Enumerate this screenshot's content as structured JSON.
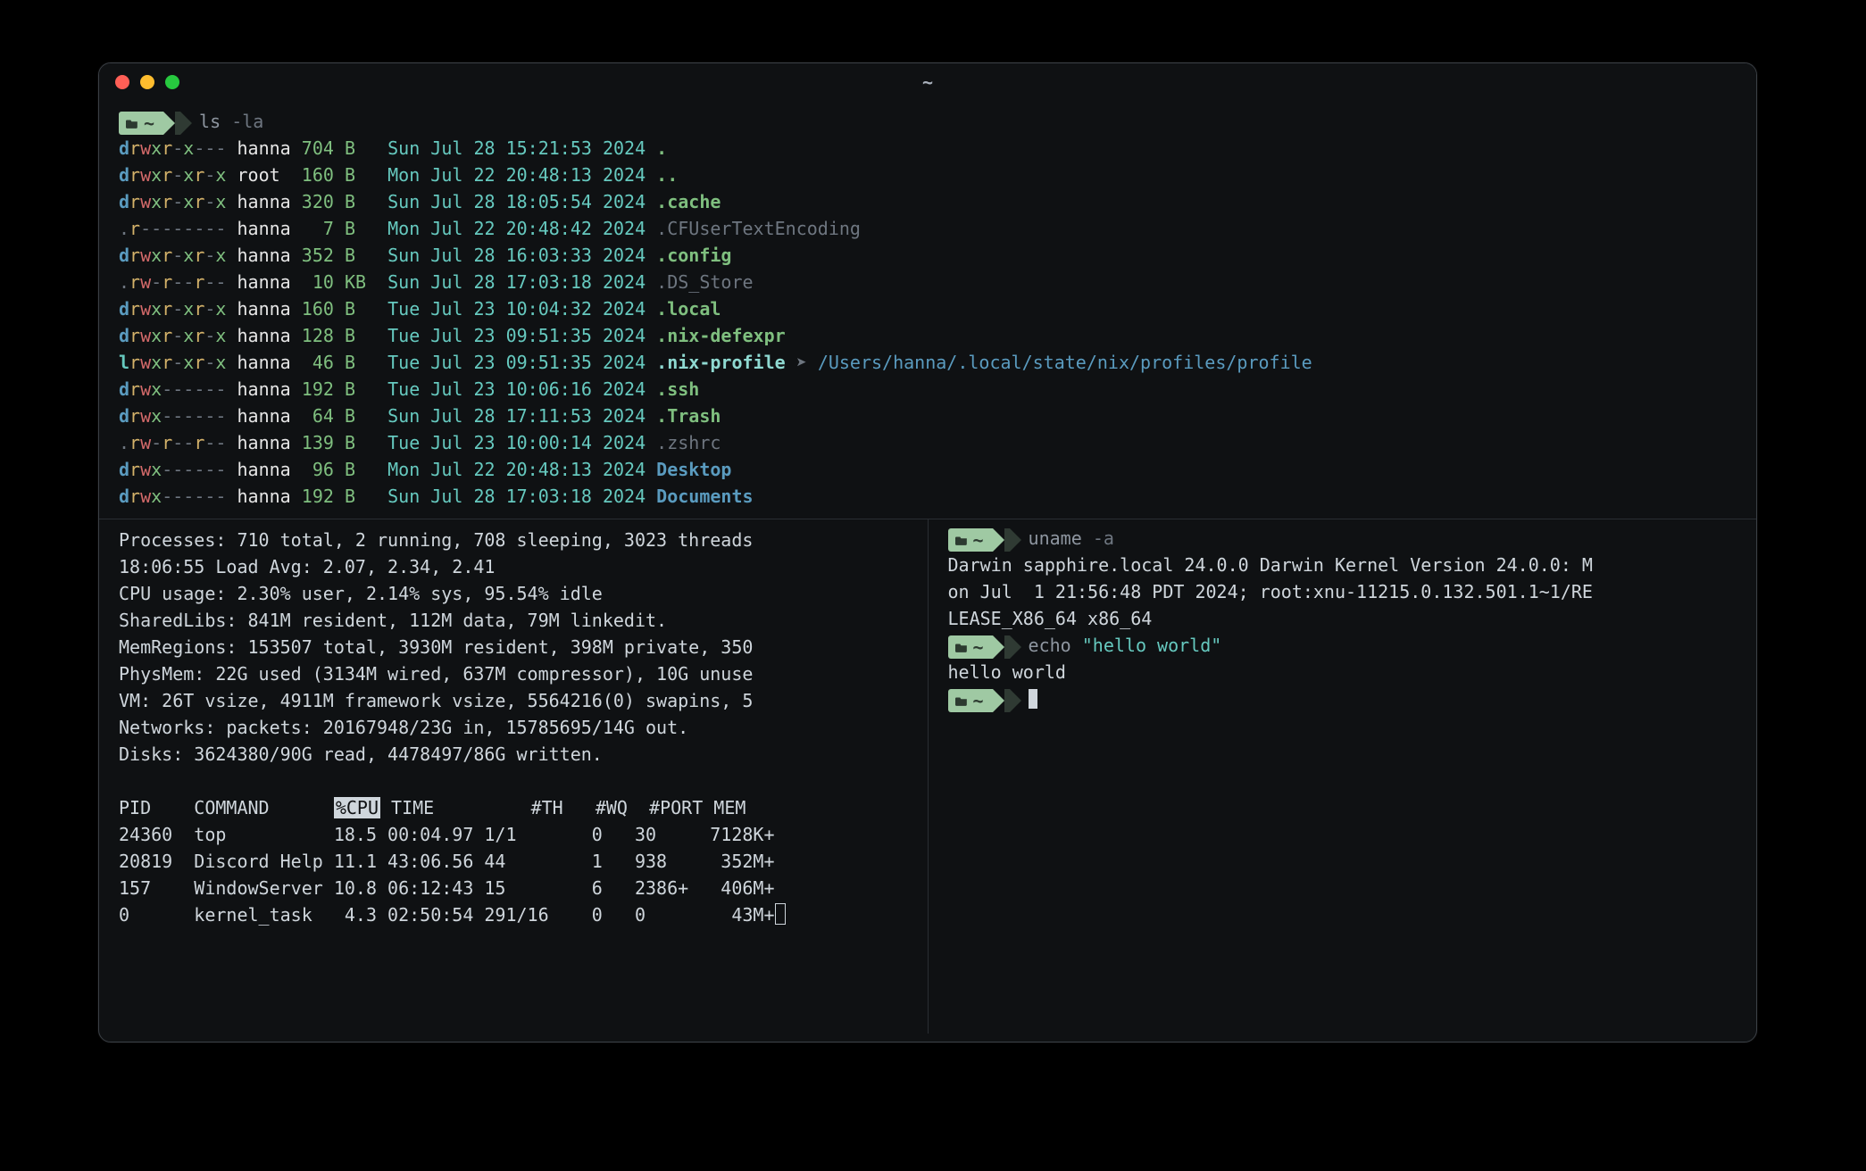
{
  "window": {
    "title": "~"
  },
  "prompt": {
    "cwd": "~"
  },
  "panes": {
    "top": {
      "command": {
        "exe": "ls",
        "args": "-la"
      },
      "rows": [
        {
          "perm_d": "d",
          "perm_u": "rwx",
          "perm_g": "r-x",
          "perm_o": "---",
          "user": "hanna",
          "size": "704",
          "unit": "B ",
          "date": "Sun Jul 28 15:21:53 2024",
          "name": ".",
          "name_style": "green bold"
        },
        {
          "perm_d": "d",
          "perm_u": "rwx",
          "perm_g": "r-x",
          "perm_o": "r-x",
          "user": "root ",
          "size": "160",
          "unit": "B ",
          "date": "Mon Jul 22 20:48:13 2024",
          "name": "..",
          "name_style": "green bold"
        },
        {
          "perm_d": "d",
          "perm_u": "rwx",
          "perm_g": "r-x",
          "perm_o": "r-x",
          "user": "hanna",
          "size": "320",
          "unit": "B ",
          "date": "Sun Jul 28 18:05:54 2024",
          "name": ".cache",
          "name_style": "green bold"
        },
        {
          "perm_d": ".",
          "perm_u": "r--",
          "perm_g": "---",
          "perm_o": "---",
          "user": "hanna",
          "size": "  7",
          "unit": "B ",
          "date": "Mon Jul 22 20:48:42 2024",
          "name": ".CFUserTextEncoding",
          "name_style": "dim"
        },
        {
          "perm_d": "d",
          "perm_u": "rwx",
          "perm_g": "r-x",
          "perm_o": "r-x",
          "user": "hanna",
          "size": "352",
          "unit": "B ",
          "date": "Sun Jul 28 16:03:33 2024",
          "name": ".config",
          "name_style": "green bold"
        },
        {
          "perm_d": ".",
          "perm_u": "rw-",
          "perm_g": "r--",
          "perm_o": "r--",
          "user": "hanna",
          "size": " 10",
          "unit": "KB",
          "date": "Sun Jul 28 17:03:18 2024",
          "name": ".DS_Store",
          "name_style": "dim"
        },
        {
          "perm_d": "d",
          "perm_u": "rwx",
          "perm_g": "r-x",
          "perm_o": "r-x",
          "user": "hanna",
          "size": "160",
          "unit": "B ",
          "date": "Tue Jul 23 10:04:32 2024",
          "name": ".local",
          "name_style": "green bold"
        },
        {
          "perm_d": "d",
          "perm_u": "rwx",
          "perm_g": "r-x",
          "perm_o": "r-x",
          "user": "hanna",
          "size": "128",
          "unit": "B ",
          "date": "Tue Jul 23 09:51:35 2024",
          "name": ".nix-defexpr",
          "name_style": "green bold"
        },
        {
          "perm_d": "l",
          "perm_u": "rwx",
          "perm_g": "r-x",
          "perm_o": "r-x",
          "user": "hanna",
          "size": " 46",
          "unit": "B ",
          "date": "Tue Jul 23 09:51:35 2024",
          "name": ".nix-profile",
          "name_style": "strteal bold",
          "link_arrow": "➤",
          "link_target": "/Users/hanna/.local/state/nix/profiles/profile"
        },
        {
          "perm_d": "d",
          "perm_u": "rwx",
          "perm_g": "---",
          "perm_o": "---",
          "user": "hanna",
          "size": "192",
          "unit": "B ",
          "date": "Tue Jul 23 10:06:16 2024",
          "name": ".ssh",
          "name_style": "green bold"
        },
        {
          "perm_d": "d",
          "perm_u": "rwx",
          "perm_g": "---",
          "perm_o": "---",
          "user": "hanna",
          "size": " 64",
          "unit": "B ",
          "date": "Sun Jul 28 17:11:53 2024",
          "name": ".Trash",
          "name_style": "green bold"
        },
        {
          "perm_d": ".",
          "perm_u": "rw-",
          "perm_g": "r--",
          "perm_o": "r--",
          "user": "hanna",
          "size": "139",
          "unit": "B ",
          "date": "Tue Jul 23 10:00:14 2024",
          "name": ".zshrc",
          "name_style": "dim"
        },
        {
          "perm_d": "d",
          "perm_u": "rwx",
          "perm_g": "---",
          "perm_o": "---",
          "user": "hanna",
          "size": " 96",
          "unit": "B ",
          "date": "Mon Jul 22 20:48:13 2024",
          "name": "Desktop",
          "name_style": "blue bold"
        },
        {
          "perm_d": "d",
          "perm_u": "rwx",
          "perm_g": "---",
          "perm_o": "---",
          "user": "hanna",
          "size": "192",
          "unit": "B ",
          "date": "Sun Jul 28 17:03:18 2024",
          "name": "Documents",
          "name_style": "blue bold"
        }
      ]
    },
    "bottom_left": {
      "summary": [
        "Processes: 710 total, 2 running, 708 sleeping, 3023 threads",
        "18:06:55 Load Avg: 2.07, 2.34, 2.41",
        "CPU usage: 2.30% user, 2.14% sys, 95.54% idle",
        "SharedLibs: 841M resident, 112M data, 79M linkedit.",
        "MemRegions: 153507 total, 3930M resident, 398M private, 350",
        "PhysMem: 22G used (3134M wired, 637M compressor), 10G unuse",
        "VM: 26T vsize, 4911M framework vsize, 5564216(0) swapins, 5",
        "Networks: packets: 20167948/23G in, 15785695/14G out.",
        "Disks: 3624380/90G read, 4478497/86G written."
      ],
      "headers": [
        "PID",
        "COMMAND",
        "%CPU",
        "TIME",
        "#TH",
        "#WQ",
        "#PORT",
        "MEM"
      ],
      "rows": [
        {
          "pid": "24360",
          "cmd": "top",
          "cpu": "18.5",
          "time": "00:04.97",
          "th": "1/1",
          "wq": "0",
          "port": "30",
          "mem": "7128K+"
        },
        {
          "pid": "20819",
          "cmd": "Discord Help",
          "cpu": "11.1",
          "time": "43:06.56",
          "th": "44",
          "wq": "1",
          "port": "938",
          "mem": "352M+"
        },
        {
          "pid": "157",
          "cmd": "WindowServer",
          "cpu": "10.8",
          "time": "06:12:43",
          "th": "15",
          "wq": "6",
          "port": "2386+",
          "mem": "406M+"
        },
        {
          "pid": "0",
          "cmd": "kernel_task",
          "cpu": "4.3",
          "time": "02:50:54",
          "th": "291/16",
          "wq": "0",
          "port": "0",
          "mem": "43M+"
        }
      ]
    },
    "bottom_right": {
      "lines": [
        {
          "type": "prompt",
          "exe": "uname",
          "args": "-a"
        },
        {
          "type": "out",
          "text": "Darwin sapphire.local 24.0.0 Darwin Kernel Version 24.0.0: M"
        },
        {
          "type": "out",
          "text": "on Jul  1 21:56:48 PDT 2024; root:xnu-11215.0.132.501.1~1/RE"
        },
        {
          "type": "out",
          "text": "LEASE_X86_64 x86_64"
        },
        {
          "type": "prompt",
          "exe": "echo",
          "args": "\"hello world\"",
          "args_style": "teal"
        },
        {
          "type": "out",
          "text": "hello world"
        },
        {
          "type": "prompt",
          "exe": "",
          "args": "",
          "cursor": true
        }
      ]
    }
  }
}
